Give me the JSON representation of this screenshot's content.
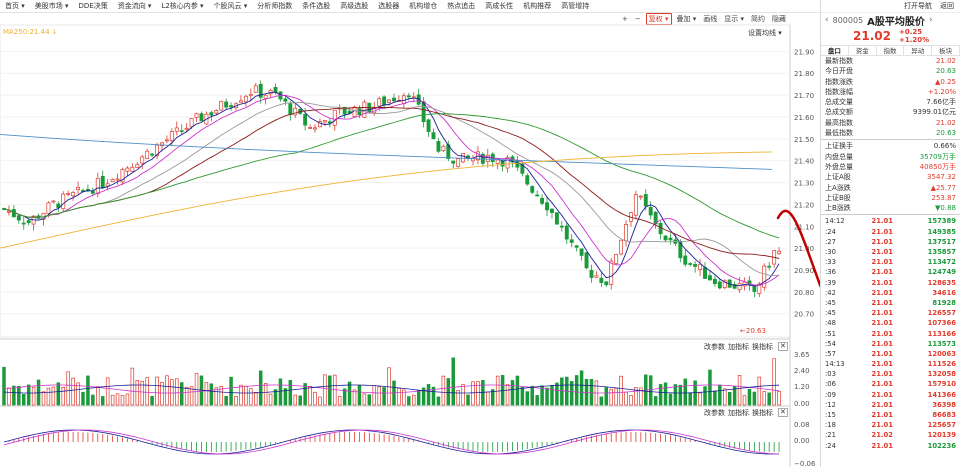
{
  "menu": [
    "首页 ▾",
    "美股市场 ▾",
    "DDE决策",
    "资金流向 ▾",
    "L2核心内参 ▾",
    "个股风云 ▾",
    "分析师指数",
    "条件选股",
    "高级选股",
    "选股器",
    "机构增仓",
    "热点追击",
    "高成长性",
    "机构推荐",
    "高管增持"
  ],
  "toolbar": {
    "buttons": [
      "+",
      "−",
      "复权 ▾",
      "叠加 ▾",
      "画线",
      "显示 ▾",
      "简约",
      "隐藏"
    ]
  },
  "indicator_label": "MA250:21.44 ↓",
  "settings_label": "设置均线 ▾",
  "sub_controls": {
    "a": "改参数",
    "b": "加指标",
    "c": "换指标",
    "x": "✕"
  },
  "price_axis": [
    "21.90",
    "21.80",
    "21.70",
    "21.60",
    "21.50",
    "21.40",
    "21.30",
    "21.20",
    "21.10",
    "21.00",
    "20.90",
    "20.80",
    "20.70"
  ],
  "vol_axis": [
    "3.65",
    "2.40",
    "1.20",
    "0.00"
  ],
  "macd_axis": [
    "0.08",
    "0.00",
    "−0.06"
  ],
  "low_marker": "←20.63",
  "right_panel": {
    "top_links": [
      "打开导航",
      "返回"
    ],
    "code": "800005",
    "name": "A股平均股价",
    "price": "21.02",
    "change": "+0.25",
    "change_pct": "+1.20%",
    "tabs": [
      "盘口",
      "资金",
      "指数",
      "异动",
      "板块"
    ],
    "stats": [
      {
        "label": "最新指数",
        "value": "21.02",
        "color": "#e03a2c"
      },
      {
        "label": "今日开盘",
        "value": "20.63",
        "color": "#1a9a3a"
      },
      {
        "label": "指数涨跌",
        "value": "▲0.25",
        "color": "#e03a2c"
      },
      {
        "label": "指数涨幅",
        "value": "+1.20%",
        "color": "#e03a2c"
      },
      {
        "label": "总成交量",
        "value": "7.66亿手",
        "color": "#333333"
      },
      {
        "label": "总成交额",
        "value": "9399.01亿元",
        "color": "#333333"
      },
      {
        "label": "最高指数",
        "value": "21.02",
        "color": "#e03a2c"
      },
      {
        "label": "最低指数",
        "value": "20.63",
        "color": "#1a9a3a"
      }
    ],
    "stats2": [
      {
        "label": "上证换手",
        "value": "0.66%",
        "color": "#333333"
      },
      {
        "label": "内盘总量",
        "value": "35709万手",
        "color": "#1a9a3a"
      },
      {
        "label": "外盘总量",
        "value": "40850万手",
        "color": "#e03a2c"
      },
      {
        "label": "上证A股",
        "value": "3547.32",
        "color": "#e03a2c"
      },
      {
        "label": "上A涨跌",
        "value": "▲25.77",
        "color": "#e03a2c"
      },
      {
        "label": "上证B股",
        "value": "253.87",
        "color": "#e03a2c"
      },
      {
        "label": "上B涨跌",
        "value": "▼0.88",
        "color": "#1a9a3a"
      }
    ],
    "ticks": [
      {
        "t": "14:12",
        "p": "21.01",
        "v": "157389",
        "c": "#1a9a3a"
      },
      {
        "t": ":24",
        "p": "21.01",
        "v": "149385",
        "c": "#1a9a3a"
      },
      {
        "t": ":27",
        "p": "21.01",
        "v": "137517",
        "c": "#1a9a3a"
      },
      {
        "t": ":30",
        "p": "21.01",
        "v": "135857",
        "c": "#1a9a3a"
      },
      {
        "t": ":33",
        "p": "21.01",
        "v": "113472",
        "c": "#1a9a3a"
      },
      {
        "t": ":36",
        "p": "21.01",
        "v": "124749",
        "c": "#1a9a3a"
      },
      {
        "t": ":39",
        "p": "21.01",
        "v": "128635",
        "c": "#e03a2c"
      },
      {
        "t": ":42",
        "p": "21.01",
        "v": "34616",
        "c": "#e03a2c"
      },
      {
        "t": ":45",
        "p": "21.01",
        "v": "81928",
        "c": "#1a9a3a"
      },
      {
        "t": ":45",
        "p": "21.01",
        "v": "126557",
        "c": "#e03a2c"
      },
      {
        "t": ":48",
        "p": "21.01",
        "v": "107366",
        "c": "#e03a2c"
      },
      {
        "t": ":51",
        "p": "21.01",
        "v": "113166",
        "c": "#e03a2c"
      },
      {
        "t": ":54",
        "p": "21.01",
        "v": "113573",
        "c": "#1a9a3a"
      },
      {
        "t": ":57",
        "p": "21.01",
        "v": "120063",
        "c": "#e03a2c"
      },
      {
        "t": "14:13",
        "p": "21.01",
        "v": "111526",
        "c": "#e03a2c"
      },
      {
        "t": ":03",
        "p": "21.01",
        "v": "132058",
        "c": "#e03a2c"
      },
      {
        "t": ":06",
        "p": "21.01",
        "v": "157910",
        "c": "#e03a2c"
      },
      {
        "t": ":09",
        "p": "21.01",
        "v": "141366",
        "c": "#e03a2c"
      },
      {
        "t": ":12",
        "p": "21.01",
        "v": "36398",
        "c": "#e03a2c"
      },
      {
        "t": ":15",
        "p": "21.01",
        "v": "86683",
        "c": "#e03a2c"
      },
      {
        "t": ":18",
        "p": "21.01",
        "v": "125657",
        "c": "#e03a2c"
      },
      {
        "t": ":21",
        "p": "21.02",
        "v": "120139",
        "c": "#e03a2c"
      },
      {
        "t": ":24",
        "p": "21.01",
        "v": "102236",
        "c": "#1a9a3a"
      }
    ]
  },
  "chart_data": {
    "type": "candlestick",
    "y_range": [
      20.63,
      21.92
    ],
    "ma_colors": {
      "ma5": "#1c1c9a",
      "ma10": "#cc33cc",
      "ma20": "#999999",
      "ma30": "#8b1a1a",
      "ma60": "#2e9a2e",
      "ma120": "#4a8ec8",
      "ma250": "#f0b030"
    },
    "up_color": "#e03a2c",
    "down_color": "#1a9a3a"
  }
}
